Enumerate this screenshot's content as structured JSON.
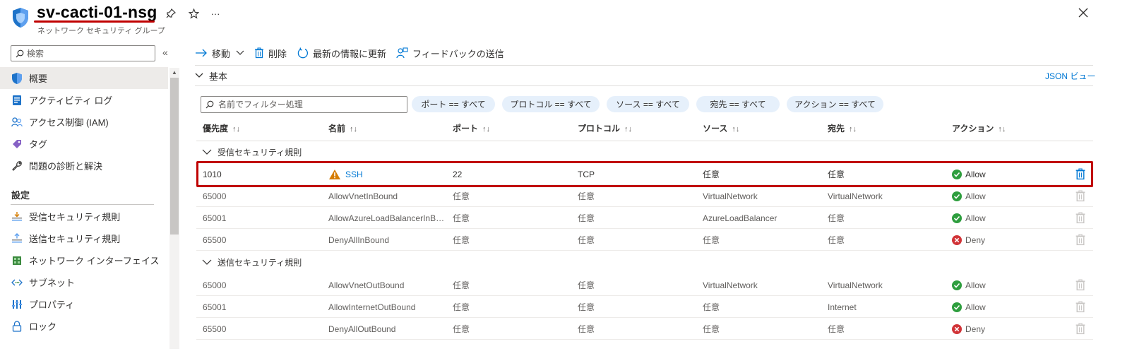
{
  "header": {
    "title": "sv-cacti-01-nsg",
    "subtitle": "ネットワーク セキュリティ グループ",
    "more": "···"
  },
  "sidebar": {
    "search_placeholder": "検索",
    "collapse": "«",
    "items": [
      {
        "label": "概要",
        "icon": "shield-icon"
      },
      {
        "label": "アクティビティ ログ",
        "icon": "activity-log-icon"
      },
      {
        "label": "アクセス制御 (IAM)",
        "icon": "people-icon"
      },
      {
        "label": "タグ",
        "icon": "tag-icon"
      },
      {
        "label": "問題の診断と解決",
        "icon": "wrench-icon"
      }
    ],
    "section": "設定",
    "settings_items": [
      {
        "label": "受信セキュリティ規則",
        "icon": "inbound-rules-icon"
      },
      {
        "label": "送信セキュリティ規則",
        "icon": "outbound-rules-icon"
      },
      {
        "label": "ネットワーク インターフェイス",
        "icon": "network-interface-icon"
      },
      {
        "label": "サブネット",
        "icon": "subnet-icon"
      },
      {
        "label": "プロパティ",
        "icon": "properties-icon"
      },
      {
        "label": "ロック",
        "icon": "lock-icon"
      }
    ]
  },
  "toolbar": {
    "move": "移動",
    "delete": "削除",
    "refresh": "最新の情報に更新",
    "feedback": "フィードバックの送信"
  },
  "essentials": {
    "label": "基本",
    "json_view": "JSON ビュー"
  },
  "filter": {
    "placeholder": "名前でフィルター処理",
    "pills": [
      "ポート == すべて",
      "プロトコル == すべて",
      "ソース == すべて",
      "宛先 == すべて",
      "アクション == すべて"
    ]
  },
  "table": {
    "columns": [
      "優先度",
      "名前",
      "ポート",
      "プロトコル",
      "ソース",
      "宛先",
      "アクション"
    ],
    "sort_glyph": "↑↓",
    "inbound_group": "受信セキュリティ規則",
    "outbound_group": "送信セキュリティ規則",
    "inbound_rows": [
      {
        "priority": "1010",
        "name": "SSH",
        "port": "22",
        "protocol": "TCP",
        "source": "任意",
        "destination": "任意",
        "action": "Allow",
        "warning": true
      },
      {
        "priority": "65000",
        "name": "AllowVnetInBound",
        "port": "任意",
        "protocol": "任意",
        "source": "VirtualNetwork",
        "destination": "VirtualNetwork",
        "action": "Allow"
      },
      {
        "priority": "65001",
        "name": "AllowAzureLoadBalancerInB…",
        "port": "任意",
        "protocol": "任意",
        "source": "AzureLoadBalancer",
        "destination": "任意",
        "action": "Allow"
      },
      {
        "priority": "65500",
        "name": "DenyAllInBound",
        "port": "任意",
        "protocol": "任意",
        "source": "任意",
        "destination": "任意",
        "action": "Deny"
      }
    ],
    "outbound_rows": [
      {
        "priority": "65000",
        "name": "AllowVnetOutBound",
        "port": "任意",
        "protocol": "任意",
        "source": "VirtualNetwork",
        "destination": "VirtualNetwork",
        "action": "Allow"
      },
      {
        "priority": "65001",
        "name": "AllowInternetOutBound",
        "port": "任意",
        "protocol": "任意",
        "source": "任意",
        "destination": "Internet",
        "action": "Allow"
      },
      {
        "priority": "65500",
        "name": "DenyAllOutBound",
        "port": "任意",
        "protocol": "任意",
        "source": "任意",
        "destination": "任意",
        "action": "Deny"
      }
    ]
  },
  "colors": {
    "accent": "#0078d4",
    "allow": "#2e9e3e",
    "deny": "#d13438",
    "warning": "#d67c00",
    "highlight": "#c00000"
  }
}
